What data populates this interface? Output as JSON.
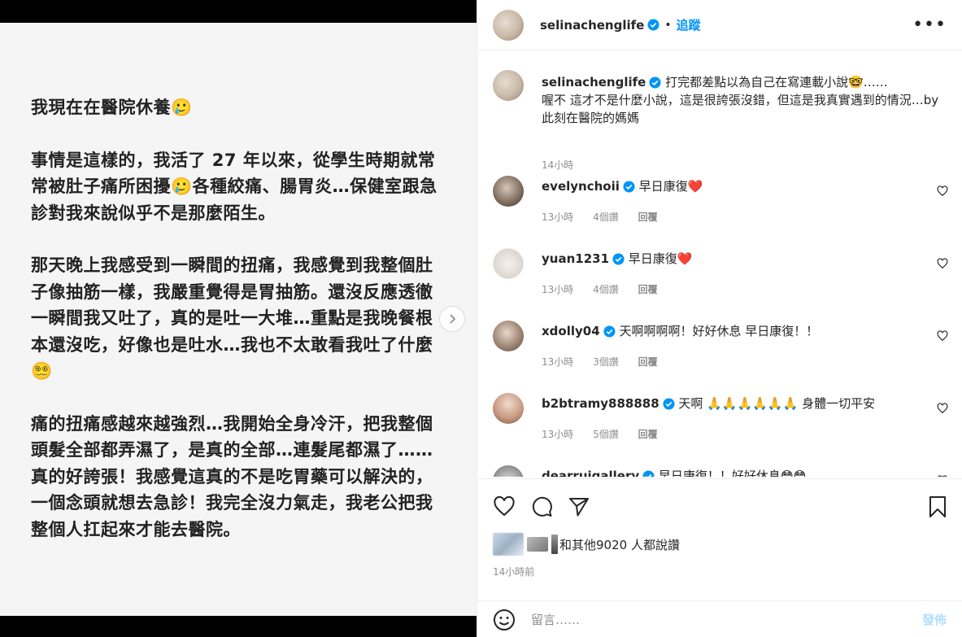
{
  "post_image": {
    "paragraphs": [
      "我現在在醫院休養🥲",
      "事情是這樣的，我活了 27 年以來，從學生時期就常常被肚子痛所困擾🥲各種絞痛、腸胃炎…保健室跟急診對我來說似乎不是那麼陌生。",
      "那天晚上我感受到一瞬間的扭痛，我感覺到我整個肚子像抽筋一樣，我嚴重覺得是胃抽筋。還沒反應透徹一瞬間我又吐了，真的是吐一大堆…重點是我晚餐根本還沒吃，好像也是吐水…我也不太敢看我吐了什麼😵‍💫",
      "痛的扭痛感越來越強烈…我開始全身冷汗，把我整個頭髮全部都弄濕了，是真的全部…連髮尾都濕了……真的好誇張！我感覺這真的不是吃胃藥可以解決的，一個念頭就想去急診！我完全沒力氣走，我老公把我整個人扛起來才能去醫院。"
    ]
  },
  "header": {
    "username": "selinachenglife",
    "dot": "•",
    "follow_label": "追蹤",
    "more_label": "•••"
  },
  "caption": {
    "username": "selinachenglife",
    "text": "打完都差點以為自己在寫連載小說🤓……\n喔不 這才不是什麼小說，這是很誇張沒錯，但這是我真實遇到的情況…by此刻在醫院的媽媽",
    "time": "14小時"
  },
  "comments": [
    {
      "username": "evelynchoii",
      "text": "早日康復",
      "emoji": "❤️",
      "time": "13小時",
      "likes": "4個讚",
      "reply": "回覆"
    },
    {
      "username": "yuan1231",
      "text": "早日康復",
      "emoji": "❤️",
      "time": "13小時",
      "likes": "4個讚",
      "reply": "回覆"
    },
    {
      "username": "xdolly04",
      "text": "天啊啊啊啊！好好休息 早日康復！！",
      "emoji": "",
      "time": "13小時",
      "likes": "3個讚",
      "reply": "回覆"
    },
    {
      "username": "b2btramy888888",
      "text": "天啊",
      "emoji": "🙏🙏🙏🙏🙏🙏",
      "text2": "身體一切平安",
      "time": "13小時",
      "likes": "5個讚",
      "reply": "回覆"
    },
    {
      "username": "dearruigallery",
      "text": "早日康復！！好好休息",
      "emoji": "😳😳",
      "time": "",
      "likes": "",
      "reply": ""
    }
  ],
  "actions": {
    "likes_text": "和其他9020 人都說讚",
    "post_time": "14小時前"
  },
  "composer": {
    "placeholder": "留言……",
    "post_label": "發佈"
  },
  "colors": {
    "accent": "#0095f6",
    "heart": "#ed4956",
    "muted": "#8e8e8e",
    "post_disabled": "#b2dffc"
  }
}
